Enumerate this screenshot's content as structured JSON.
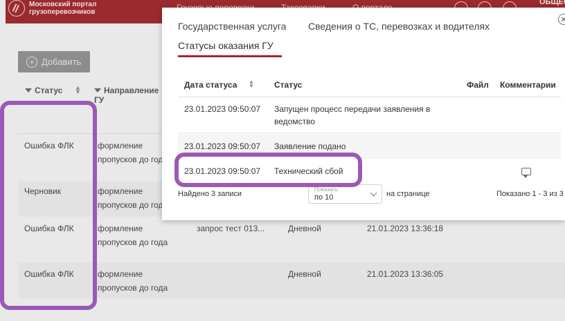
{
  "header": {
    "logo_line1": "Московский портал",
    "logo_line2": "грузоперевозчиков",
    "nav": [
      "Грузовые перевозки",
      "Таксопарки",
      "О портале"
    ],
    "user": "ОБЩЕСТВО"
  },
  "toolbar": {
    "add_label": "Добавить"
  },
  "list": {
    "columns": [
      "Статус",
      "Направление ГУ"
    ],
    "rows": [
      {
        "status": "Ошибка ФЛК",
        "direction": "формление пропусков до года",
        "name": "",
        "type": "",
        "date": ""
      },
      {
        "status": "Черновик",
        "direction": "формление пропусков до года",
        "name": "",
        "type": "",
        "date": ""
      },
      {
        "status": "Ошибка ФЛК",
        "direction": "формление пропусков до года",
        "name": "запрос тест 013...",
        "type": "Дневной",
        "date": "21.01.2023 13:36:18"
      },
      {
        "status": "Ошибка ФЛК",
        "direction": "формление пропусков до года",
        "name": "",
        "type": "Дневной",
        "date": "21.01.2023 13:36:05"
      }
    ]
  },
  "modal": {
    "tabs": [
      "Государственная услуга",
      "Сведения о ТС, перевозках и водителях"
    ],
    "subtab": "Статусы оказания ГУ",
    "columns": [
      "Дата статуса",
      "Статус",
      "Файл",
      "Комментарии"
    ],
    "rows": [
      {
        "date": "23.01.2023  09:50:07",
        "status": "Запущен процесс передачи заявления в ведомство"
      },
      {
        "date": "23.01.2023  09:50:07",
        "status": "Заявление подано"
      },
      {
        "date": "23.01.2023  09:50:07",
        "status": "Технический сбой"
      }
    ],
    "found": "Найдено 3 записи",
    "pager_label": "Показать",
    "pager_value": "по 10",
    "per_page": "на странице",
    "shown": "Показано 1 - 3 из 3"
  }
}
